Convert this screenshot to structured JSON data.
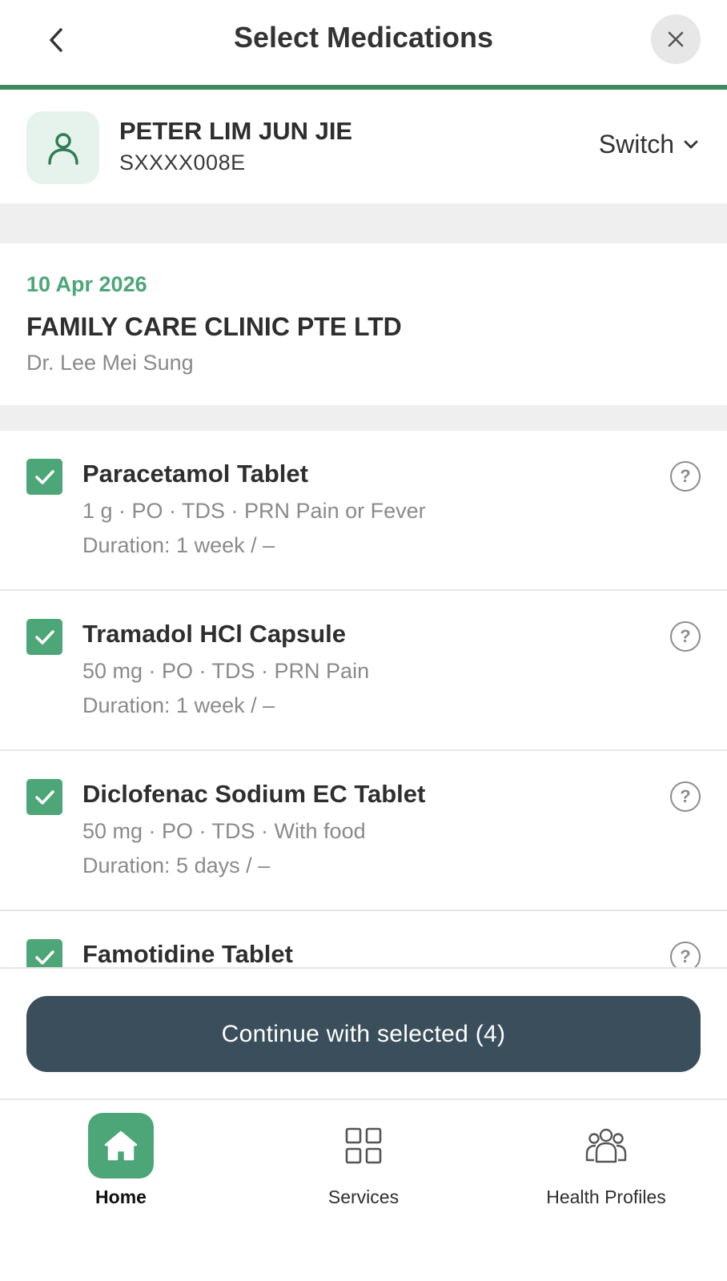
{
  "header": {
    "title": "Select Medications",
    "progress_percent": 100,
    "accent_color": "#3f8a5e"
  },
  "patient": {
    "name": "PETER LIM JUN JIE",
    "id": "SXXXX008E",
    "switch_label": "Switch"
  },
  "visit": {
    "date": "10 Apr 2026",
    "clinic": "FAMILY CARE CLINIC PTE LTD",
    "doctor": "Dr. Lee Mei Sung"
  },
  "medications": [
    {
      "name": "Paracetamol Tablet",
      "detail": "1 g · PO · TDS · PRN Pain or Fever",
      "duration": "Duration: 1 week / –",
      "checked": true
    },
    {
      "name": "Tramadol HCl Capsule",
      "detail": "50 mg · PO · TDS · PRN Pain",
      "duration": "Duration: 1 week / –",
      "checked": true
    },
    {
      "name": "Diclofenac Sodium EC Tablet",
      "detail": "50 mg · PO · TDS · With food",
      "duration": "Duration: 5 days / –",
      "checked": true
    },
    {
      "name": "Famotidine Tablet",
      "detail": "",
      "duration": "",
      "checked": true
    }
  ],
  "help_glyph": "?",
  "continue_label": "Continue with selected (4)",
  "nav": {
    "items": [
      {
        "label": "Home",
        "icon": "home-icon",
        "active": true
      },
      {
        "label": "Services",
        "icon": "grid-icon",
        "active": false
      },
      {
        "label": "Health Profiles",
        "icon": "people-icon",
        "active": false
      }
    ]
  },
  "colors": {
    "brand_green": "#4ca677",
    "button_dark": "#3a4f5b"
  }
}
